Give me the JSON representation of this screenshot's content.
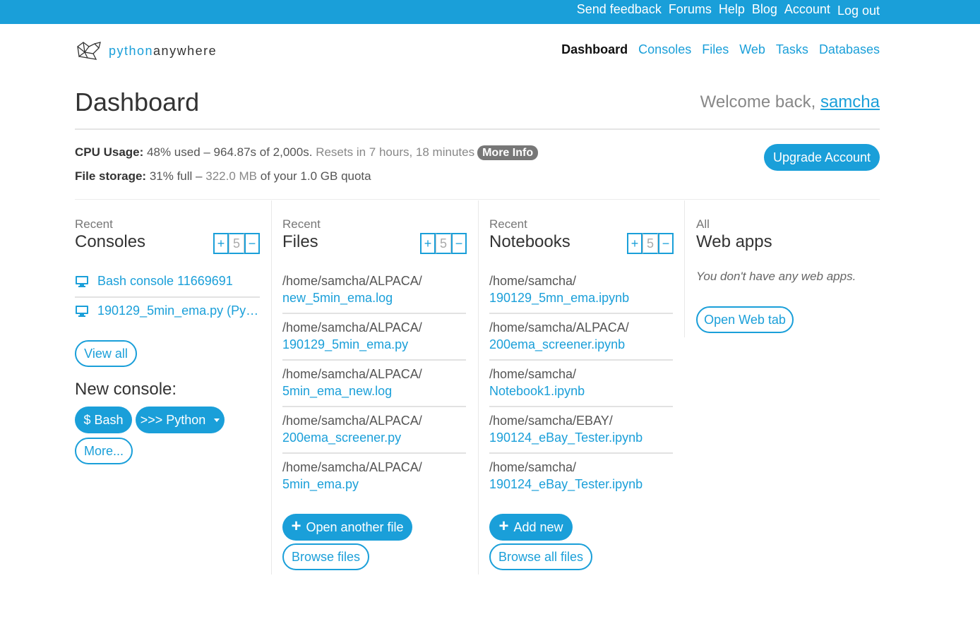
{
  "topbar": {
    "links": [
      "Send feedback",
      "Forums",
      "Help",
      "Blog",
      "Account",
      "Log out"
    ]
  },
  "logo": {
    "python": "python",
    "anywhere": "anywhere"
  },
  "nav": {
    "items": [
      "Dashboard",
      "Consoles",
      "Files",
      "Web",
      "Tasks",
      "Databases"
    ],
    "active": "Dashboard"
  },
  "header": {
    "title": "Dashboard",
    "welcome_prefix": "Welcome back, ",
    "username": "samcha"
  },
  "usage": {
    "cpu_label": "CPU Usage:",
    "cpu_value": "48% used – 964.87s of 2,000s.",
    "cpu_reset": "Resets in 7 hours, 18 minutes",
    "more_info": "More Info",
    "storage_label": "File storage:",
    "storage_pct": "31% full –",
    "storage_used": "322.0 MB",
    "storage_quota": "of your 1.0 GB quota",
    "upgrade": "Upgrade Account"
  },
  "consoles": {
    "small": "Recent",
    "big": "Consoles",
    "counter": {
      "plus": "+",
      "value": "5",
      "minus": "−"
    },
    "items": [
      "Bash console 11669691",
      "190129_5min_ema.py (Py…"
    ],
    "view_all": "View all",
    "new_console": "New console:",
    "bash": "$ Bash",
    "python": ">>> Python",
    "more": "More..."
  },
  "files": {
    "small": "Recent",
    "big": "Files",
    "counter": {
      "plus": "+",
      "value": "5",
      "minus": "−"
    },
    "items": [
      {
        "path": "/home/samcha/ALPACA/",
        "file": "new_5min_ema.log"
      },
      {
        "path": "/home/samcha/ALPACA/",
        "file": "190129_5min_ema.py"
      },
      {
        "path": "/home/samcha/ALPACA/",
        "file": "5min_ema_new.log"
      },
      {
        "path": "/home/samcha/ALPACA/",
        "file": "200ema_screener.py"
      },
      {
        "path": "/home/samcha/ALPACA/",
        "file": "5min_ema.py"
      }
    ],
    "open_another": "Open another file",
    "browse": "Browse files"
  },
  "notebooks": {
    "small": "Recent",
    "big": "Notebooks",
    "counter": {
      "plus": "+",
      "value": "5",
      "minus": "−"
    },
    "items": [
      {
        "path": "/home/samcha/",
        "file": "190129_5mn_ema.ipynb"
      },
      {
        "path": "/home/samcha/ALPACA/",
        "file": "200ema_screener.ipynb"
      },
      {
        "path": "/home/samcha/",
        "file": "Notebook1.ipynb"
      },
      {
        "path": "/home/samcha/EBAY/",
        "file": "190124_eBay_Tester.ipynb"
      },
      {
        "path": "/home/samcha/",
        "file": "190124_eBay_Tester.ipynb"
      }
    ],
    "add_new": "Add new",
    "browse_all": "Browse all files"
  },
  "webapps": {
    "small": "All",
    "big": "Web apps",
    "empty": "You don't have any web apps.",
    "open_tab": "Open Web tab"
  }
}
